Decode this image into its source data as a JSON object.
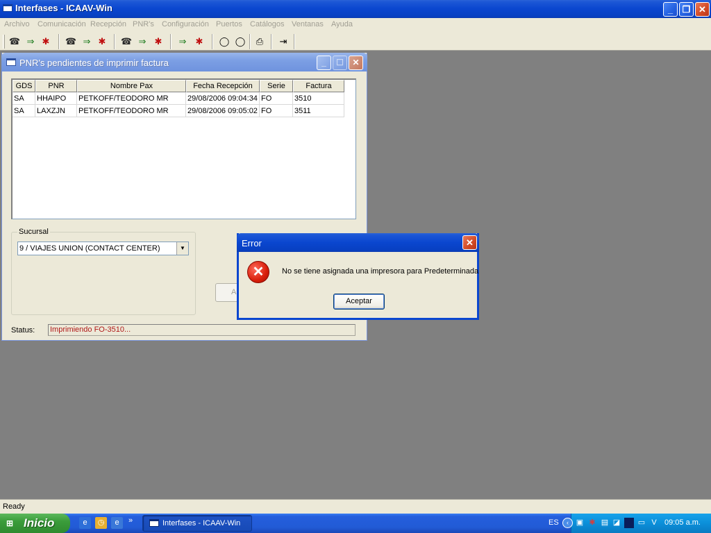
{
  "app": {
    "title": "Interfases - ICAAV-Win",
    "status": "Ready"
  },
  "menu": {
    "items": [
      "Archivo",
      "Comunicación",
      "Recepción",
      "PNR's",
      "Configuración",
      "Puertos",
      "Catálogos",
      "Ventanas",
      "Ayuda"
    ]
  },
  "toolbar": {
    "icons": [
      "comm-send-icon",
      "transfer-icon",
      "stop-bug-icon",
      "comm-send-icon",
      "transfer-icon",
      "stop-bug-icon",
      "comm-send-icon",
      "transfer-icon",
      "stop-bug-icon",
      "transfer-icon",
      "stop-bug-icon",
      "ellipse-1-icon",
      "ellipse-2-icon",
      "printer-icon",
      "exit-door-icon"
    ]
  },
  "child_window": {
    "title": "PNR's pendientes de imprimir factura",
    "table": {
      "columns": [
        "GDS",
        "PNR",
        "Nombre Pax",
        "Fecha Recepción",
        "Serie",
        "Factura"
      ],
      "rows": [
        [
          "SA",
          "HHAIPO",
          "PETKOFF/TEODORO MR",
          "29/08/2006 09:04:34",
          "FO",
          "3510"
        ],
        [
          "SA",
          "LAXZJN",
          "PETKOFF/TEODORO MR",
          "29/08/2006 09:05:02",
          "FO",
          "3511"
        ]
      ]
    },
    "sucursal": {
      "label": "Sucursal",
      "selected": "9 / VIAJES UNION (CONTACT CENTER)"
    },
    "hidden_button_label": "A",
    "status_label": "Status:",
    "status_value": "Imprimiendo FO-3510..."
  },
  "dialog": {
    "title": "Error",
    "message": "No se tiene asignada una impresora para Predeterminada",
    "ok_label": "Aceptar"
  },
  "taskbar": {
    "start_label": "Inicio",
    "task_label": "Interfases - ICAAV-Win",
    "language": "ES",
    "clock": "09:05 a.m."
  }
}
